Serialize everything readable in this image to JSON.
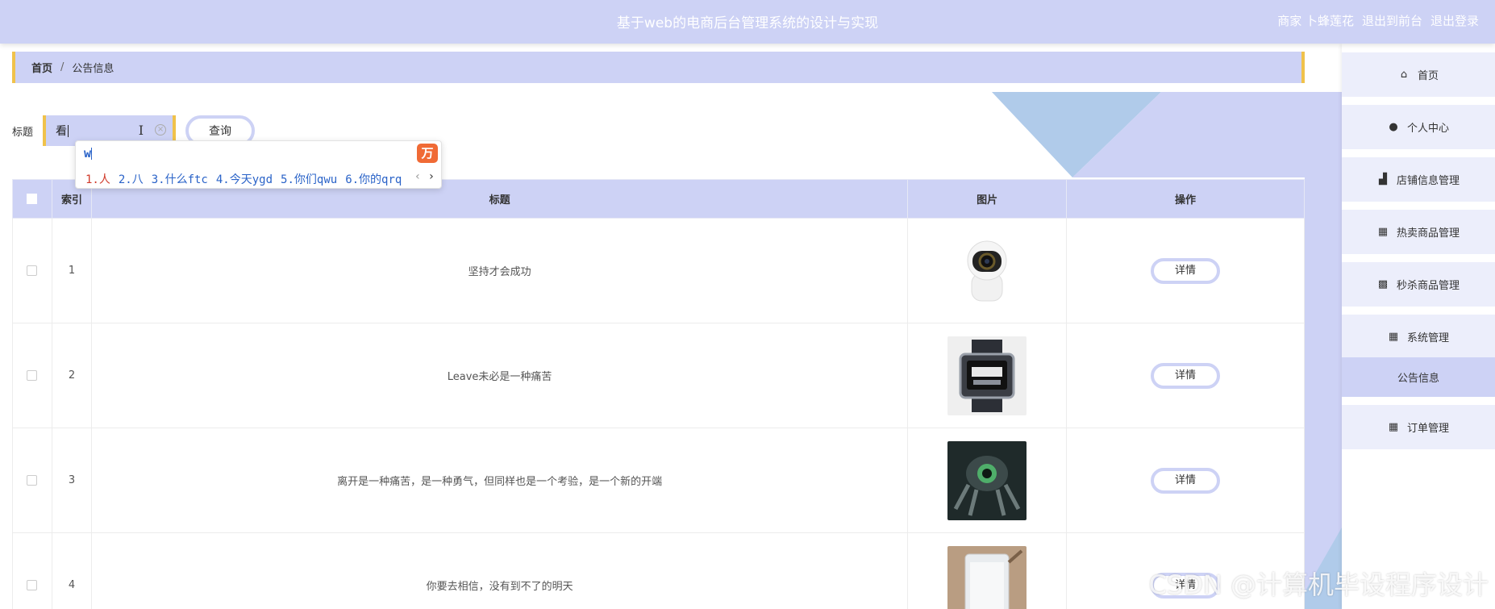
{
  "header": {
    "title": "基于web的电商后台管理系统的设计与实现",
    "user_links": [
      "商家 卜蜂莲花",
      "退出到前台",
      "退出登录"
    ]
  },
  "breadcrumb": {
    "home": "首页",
    "separator": "/",
    "current": "公告信息"
  },
  "search": {
    "label": "标题",
    "value": "看",
    "button": "查询"
  },
  "ime": {
    "composition": "w",
    "candidates": [
      "1.人",
      "2.八",
      "3.什么ftc",
      "4.今天ygd",
      "5.你们qwu",
      "6.你的qrq"
    ],
    "logo_icon": "ime-brand-icon"
  },
  "table": {
    "columns": [
      "索引",
      "标题",
      "图片",
      "操作"
    ],
    "rows": [
      {
        "index": "1",
        "title": "坚持才会成功",
        "image": "camera",
        "action": "详情"
      },
      {
        "index": "2",
        "title": "Leave未必是一种痛苦",
        "image": "smartwatch",
        "action": "详情"
      },
      {
        "index": "3",
        "title": "离开是一种痛苦，是一种勇气，但同样也是一个考验，是一个新的开端",
        "image": "robot",
        "action": "详情"
      },
      {
        "index": "4",
        "title": "你要去相信，没有到不了的明天",
        "image": "tablet",
        "action": "详情"
      }
    ]
  },
  "sidebar": {
    "items": [
      {
        "label": "首页",
        "icon": "home-icon"
      },
      {
        "label": "个人中心",
        "icon": "user-icon"
      },
      {
        "label": "店铺信息管理",
        "icon": "store-icon"
      },
      {
        "label": "热卖商品管理",
        "icon": "grid-icon"
      },
      {
        "label": "秒杀商品管理",
        "icon": "grid3-icon"
      },
      {
        "label": "系统管理",
        "icon": "grid-icon"
      },
      {
        "label": "订单管理",
        "icon": "grid-icon"
      }
    ],
    "active_sub": "公告信息"
  },
  "colors": {
    "primary": "#cdd2f5",
    "accent": "#f0c24b",
    "deco": "#b0cbea"
  },
  "watermark": "CSDN @计算机毕设程序设计"
}
